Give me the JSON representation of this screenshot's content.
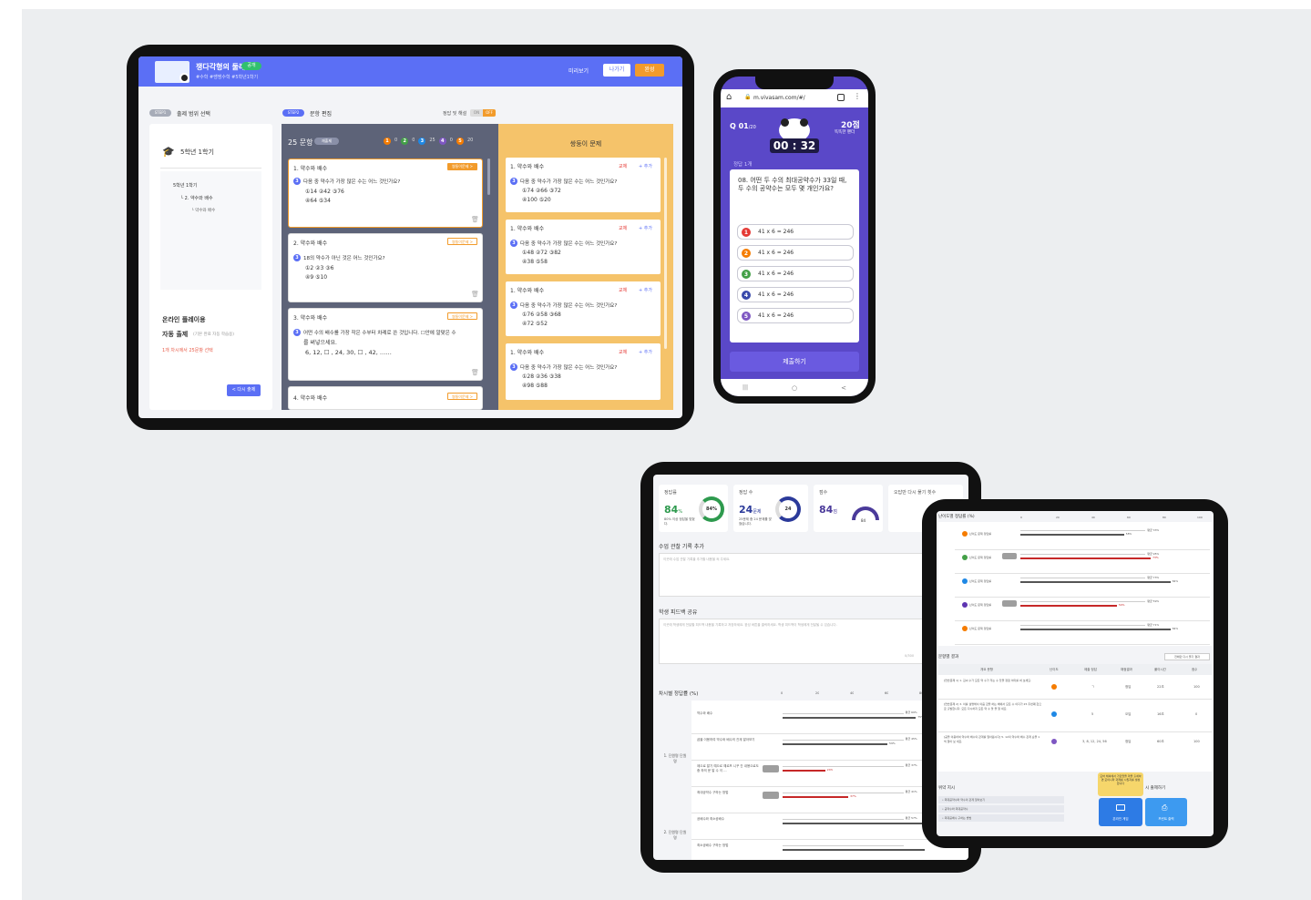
{
  "tablet1": {
    "app_title": "쟁다각형의 둘레",
    "app_badge": "공개",
    "subtitle": "#수학 #쌩쌩수학 #5학년1학기",
    "header_buttons": {
      "preview": "미리보기",
      "exit": "나가기",
      "done": "완성"
    },
    "step1": {
      "badge": "STEP1",
      "label": "출제 범위 선택"
    },
    "step2": {
      "badge": "STEP2",
      "label": "문항 편집"
    },
    "answer_toggle": {
      "label": "정답 및 해설",
      "on": "ON",
      "off": "OFF"
    },
    "left_panel": {
      "grade": "5학년 1학기",
      "tree": [
        "5학년 1학기",
        "└ 2. 약수와 배수",
        "└ 약수와 배수"
      ],
      "online_title": "온라인 플레이용",
      "auto_title": "자동 출제",
      "auto_note": "(기본 완료 자동 학습용)",
      "auto_desc": "1개 차시에서 25문항 선택",
      "redo_button": "< 다시 출제"
    },
    "question_panel": {
      "count": "25 문항",
      "count_tag": "재출제",
      "level_counts": [
        "0",
        "0",
        "25",
        "0",
        "20"
      ],
      "questions": [
        {
          "head": "1. 약수와 배수",
          "tag": "쌍둥이문제 >",
          "q": "다음 중 약수가 가장 많은 수는 어느 것인가요?",
          "opts": [
            "①14  ②42  ③76",
            "④64  ⑤34"
          ]
        },
        {
          "head": "2. 약수와 배수",
          "tag": "쌍둥이문제 >",
          "q": "18의 약수가 아닌 것은 어느 것인가요?",
          "opts": [
            "①2  ②3  ③6",
            "④9  ⑤10"
          ]
        },
        {
          "head": "3. 약수와 배수",
          "tag": "쌍둥이문제 >",
          "q": "어떤 수의 배수를 가장 작은 수부터 차례로 쓴 것입니다. ☐안에 알맞은 수",
          "opts": [
            "를 써넣으세요.",
            "6, 12, ☐ , 24, 30, ☐ , 42, ……"
          ]
        },
        {
          "head": "4. 약수와 배수",
          "tag": "쌍둥이문제 >",
          "q": "",
          "opts": []
        }
      ]
    },
    "twin_panel": {
      "title": "쌍둥이 문제",
      "swap": "교체",
      "add": "+ 추가",
      "questions": [
        {
          "head": "1. 약수와 배수",
          "q": "다음 중 약수가 가장 많은 수는 어느 것인가요?",
          "opts": [
            "①74  ②66  ③72",
            "④100  ⑤20"
          ]
        },
        {
          "head": "1. 약수와 배수",
          "q": "다음 중 약수가 가장 많은 수는 어느 것인가요?",
          "opts": [
            "①48  ②72  ③82",
            "④38  ⑤58"
          ]
        },
        {
          "head": "1. 약수와 배수",
          "q": "다음 중 약수가 가장 많은 수는 어느 것인가요?",
          "opts": [
            "①76  ②58  ③68",
            "④72  ⑤52"
          ]
        },
        {
          "head": "1. 약수와 배수",
          "q": "다음 중 약수가 가장 많은 수는 어느 것인가요?",
          "opts": [
            "①28  ②36  ③38",
            "④98  ⑤88"
          ]
        }
      ]
    }
  },
  "phone": {
    "url": "m.vivasam.com/#/",
    "q_num": "Q 01",
    "q_total": "/20",
    "score": "20점",
    "score_sub": "똑똑한 팬더",
    "timer": "00 : 32",
    "correct": "정답 1개",
    "question": "08. 어떤 두 수의 최대공약수가 33일 때, 두 수의 공약수는 모두 몇 개인가요?",
    "options": [
      "41 x 6 = 246",
      "41 x 6 = 246",
      "41 x 6 = 246",
      "41 x 6 = 246",
      "41 x 6 = 246"
    ],
    "option_colors": [
      "#e53935",
      "#f57c00",
      "#43a047",
      "#3949ab",
      "#7e57c2"
    ],
    "submit": "제출하기",
    "nav": [
      "|||",
      "○",
      "<"
    ]
  },
  "tablet2": {
    "stats": [
      {
        "label": "정답률",
        "value": "84",
        "unit": "%",
        "note": "80% 이상 정답을 맞혔다.",
        "ring": "84%"
      },
      {
        "label": "정답 수",
        "value": "24",
        "unit": "문제",
        "note": "25문제 중 24 문제를 맞혔습니다.",
        "ring": "24"
      },
      {
        "label": "점수",
        "value": "84",
        "unit": "점",
        "gauge": "84"
      },
      {
        "label": "오답만 다시 풀기 횟수",
        "value": "",
        "unit": "",
        "note": "초등 모드 미..."
      }
    ],
    "memo_title": "수업 관찰 기록 추가",
    "memo_placeholder": "이곳에 수업 관찰 기록을 추가할 내용을 써 주세요.",
    "feedback_title": "학생 피드백 공유",
    "feedback_placeholder": "이곳에 학생에게 전달할 피드백 내용을 기록하고 저장하세요. 완성 버튼을 클릭하세요. 학생 피드백이 학생에게 전달될 수 있습니다.",
    "feedback_count": "0/300",
    "chart_title": "차시별 정답률 (%)",
    "axis": [
      "0",
      "20",
      "40",
      "60",
      "80"
    ],
    "groups": [
      {
        "label": "1. 단원명 단원명",
        "rows": [
          {
            "name": "약수와 배수",
            "avg": "평균 69%",
            "val": "75%",
            "pct": 75,
            "red": false,
            "tag": false
          },
          {
            "name": "곱을 이용하여 약수와 배수의 관계 알아보기",
            "avg": "평균 45%",
            "val": "59%",
            "pct": 59,
            "red": false,
            "tag": false
          },
          {
            "name": "제으로 알기 예으르 예르프 니꾸 간 내용으로도 중 하의 문 알 수 이 ...",
            "avg": "평균 37%",
            "val": "24%",
            "pct": 24,
            "red": true,
            "tag": true
          },
          {
            "name": "최대공약수 구하는 방법",
            "avg": "평균 41%",
            "val": "37%",
            "pct": 37,
            "red": true,
            "tag": true
          }
        ]
      },
      {
        "label": "2. 단원명 단원명",
        "rows": [
          {
            "name": "공배수와 최소공배수",
            "avg": "평균 57%",
            "val": "88%",
            "pct": 88,
            "red": false,
            "tag": false
          },
          {
            "name": "최소공배수 구하는 방법",
            "avg": "",
            "val": "",
            "pct": 90,
            "red": false,
            "tag": false
          }
        ]
      }
    ]
  },
  "tablet3": {
    "level_title": "난이도별 정답률 (%)",
    "axis": [
      "0",
      "20",
      "40",
      "60",
      "80",
      "100"
    ],
    "levels": [
      {
        "label": "난이도 문제 정답률",
        "color": "#f57c00",
        "avg": "평균 33%",
        "val": "58%",
        "pct": 58,
        "red": false,
        "tag": false
      },
      {
        "label": "난이도 문제 정답률",
        "color": "#43a047",
        "avg": "평균 95%",
        "val": "73%",
        "pct": 73,
        "red": true,
        "tag": true
      },
      {
        "label": "난이도 문제 정답률",
        "color": "#1e88e5",
        "avg": "평균 73%",
        "val": "84%",
        "pct": 84,
        "red": false,
        "tag": false
      },
      {
        "label": "난이도 문제 정답률",
        "color": "#5e35b1",
        "avg": "평균 59%",
        "val": "54%",
        "pct": 54,
        "red": true,
        "tag": true
      },
      {
        "label": "난이도 문제 정답률",
        "color": "#f57c00",
        "avg": "평균 71%",
        "val": "84%",
        "pct": 84,
        "red": false,
        "tag": false
      }
    ],
    "results_title": "문항별 결과",
    "results_filter": "전체만 다시 풀기 결과",
    "columns": [
      "개요 문항",
      "난이도",
      "제출 정답",
      "채점결과",
      "풀이시간",
      "점수"
    ],
    "rows": [
      {
        "q": "[연습문제 1] 1. 김씨 수가 모든 약 수가 저는 수 있을 정점 이미를 써 보세요.",
        "lvl": "#f57c00",
        "ans": "ㄱ",
        "res": "정답",
        "time": "22초",
        "score": "100"
      },
      {
        "q": "[연습문제 2] 3. 이를 설명해서 이음 값을 하는 배에서 모든 수 이다가 25 두번째 값으로 출발합니다. 모든 다시하지 모든 약 수 맞 을 알 세요.",
        "lvl": "#1e88e5",
        "ans": "5",
        "res": "오답",
        "time": "16초",
        "score": "0"
      },
      {
        "q": "[공을 이용하여 약수와 배수의 관계를 알아봅시다] 5. 12의 약수와 배수 관계 순을 1 씩 알아 보 세요.",
        "lvl": "#7e57c2",
        "ans": "3, 8, 12, 24, 56",
        "res": "정답",
        "time": "60초",
        "score": "100"
      }
    ],
    "tooltip": "모바 채셔에서 가린었을 마을 출세하면 모이니라 과제를 시킬지를 생성 합니다",
    "recommend_title": "위약 지시",
    "recommend_items": [
      "• 최대공약수와 약수의 관계 알아보기",
      "• 공약수와 최대공약수",
      "• 최대공배수 구하는 방법"
    ],
    "extra_title": "시 출제하기",
    "buttons": [
      "온라인 게임",
      "프린트 출력"
    ]
  }
}
